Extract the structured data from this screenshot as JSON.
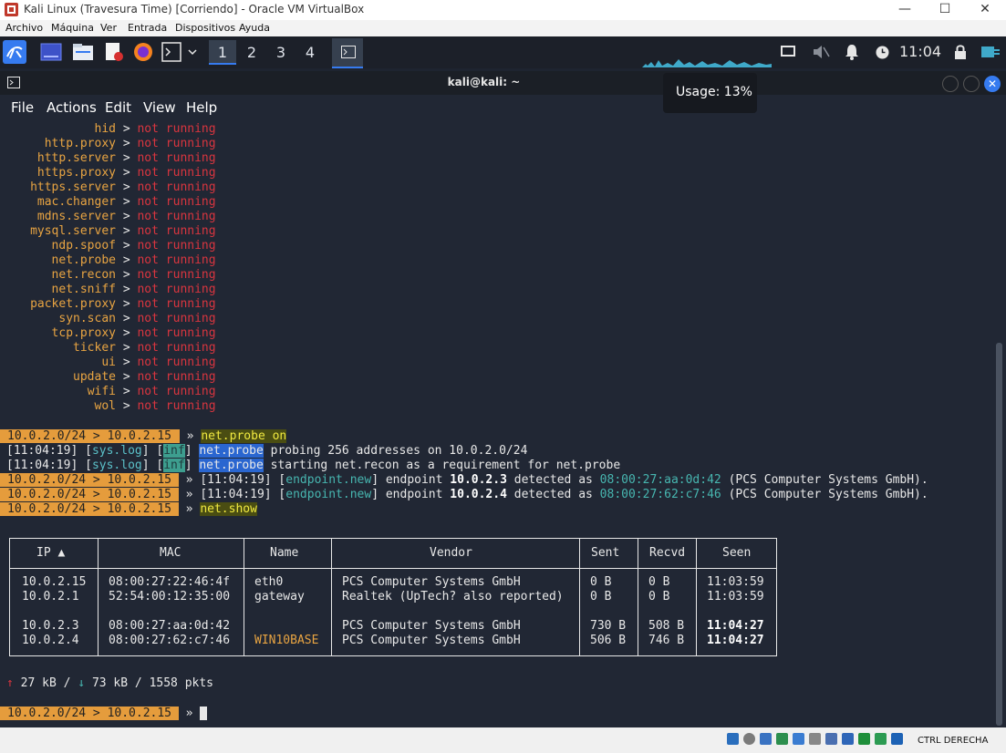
{
  "window": {
    "title": "Kali Linux (Travesura Time) [Corriendo] - Oracle VM VirtualBox"
  },
  "vbox_menu": [
    "Archivo",
    "Máquina",
    "Ver",
    "Entrada",
    "Dispositivos",
    "Ayuda"
  ],
  "panel": {
    "workspaces": [
      "1",
      "2",
      "3",
      "4"
    ],
    "active_workspace": "1",
    "clock": "11:04"
  },
  "tooltip": {
    "text": "Usage: 13%"
  },
  "terminal": {
    "title": "kali@kali: ~",
    "menu": [
      "File",
      "Actions",
      "Edit",
      "View",
      "Help"
    ]
  },
  "modules": [
    {
      "name": "hid",
      "status": "not running"
    },
    {
      "name": "http.proxy",
      "status": "not running"
    },
    {
      "name": "http.server",
      "status": "not running"
    },
    {
      "name": "https.proxy",
      "status": "not running"
    },
    {
      "name": "https.server",
      "status": "not running"
    },
    {
      "name": "mac.changer",
      "status": "not running"
    },
    {
      "name": "mdns.server",
      "status": "not running"
    },
    {
      "name": "mysql.server",
      "status": "not running"
    },
    {
      "name": "ndp.spoof",
      "status": "not running"
    },
    {
      "name": "net.probe",
      "status": "not running"
    },
    {
      "name": "net.recon",
      "status": "not running"
    },
    {
      "name": "net.sniff",
      "status": "not running"
    },
    {
      "name": "packet.proxy",
      "status": "not running"
    },
    {
      "name": "syn.scan",
      "status": "not running"
    },
    {
      "name": "tcp.proxy",
      "status": "not running"
    },
    {
      "name": "ticker",
      "status": "not running"
    },
    {
      "name": "ui",
      "status": "not running"
    },
    {
      "name": "update",
      "status": "not running"
    },
    {
      "name": "wifi",
      "status": "not running"
    },
    {
      "name": "wol",
      "status": "not running"
    }
  ],
  "prompt": "10.0.2.0/24 > 10.0.2.15",
  "log": {
    "cmd1": "net.probe on",
    "ts1": "[11:04:19]",
    "syslog": "sys.log",
    "inf": "inf",
    "netprobe": "net.probe",
    "msg1": "probing 256 addresses on 10.0.2.0/24",
    "msg2": "starting net.recon as a requirement for net.probe",
    "ep_tag": "endpoint.new",
    "ep_word": "endpoint",
    "ep1_ip": "10.0.2.3",
    "ep1_mac": "08:00:27:aa:0d:42",
    "ep2_ip": "10.0.2.4",
    "ep2_mac": "08:00:27:62:c7:46",
    "detected": "detected as",
    "vendor_tail": "(PCS Computer Systems GmbH).",
    "cmd2": "net.show"
  },
  "table": {
    "headers": [
      "IP ▲",
      "MAC",
      "Name",
      "Vendor",
      "Sent",
      "Recvd",
      "Seen"
    ],
    "rows": [
      {
        "ip": "10.0.2.15",
        "mac": "08:00:27:22:46:4f",
        "name": "eth0",
        "vendor": "PCS Computer Systems GmbH",
        "sent": "0 B",
        "recvd": "0 B",
        "seen": "11:03:59"
      },
      {
        "ip": "10.0.2.1",
        "mac": "52:54:00:12:35:00",
        "name": "gateway",
        "vendor": "Realtek (UpTech? also reported)",
        "sent": "0 B",
        "recvd": "0 B",
        "seen": "11:03:59"
      },
      {
        "ip": "10.0.2.3",
        "mac": "08:00:27:aa:0d:42",
        "name": "",
        "vendor": "PCS Computer Systems GmbH",
        "sent": "730 B",
        "recvd": "508 B",
        "seen": "11:04:27"
      },
      {
        "ip": "10.0.2.4",
        "mac": "08:00:27:62:c7:46",
        "name": "WIN10BASE",
        "vendor": "PCS Computer Systems GmbH",
        "sent": "506 B",
        "recvd": "746 B",
        "seen": "11:04:27"
      }
    ]
  },
  "traffic": {
    "up": "27 kB",
    "down": "73 kB",
    "pkts": "1558 pkts"
  },
  "status_bar": {
    "host_key": "CTRL DERECHA"
  },
  "colors": {
    "prompt": "#e59c3c",
    "not_running": "#d9353f",
    "module": "#e8a442",
    "accent": "#367bf0"
  }
}
